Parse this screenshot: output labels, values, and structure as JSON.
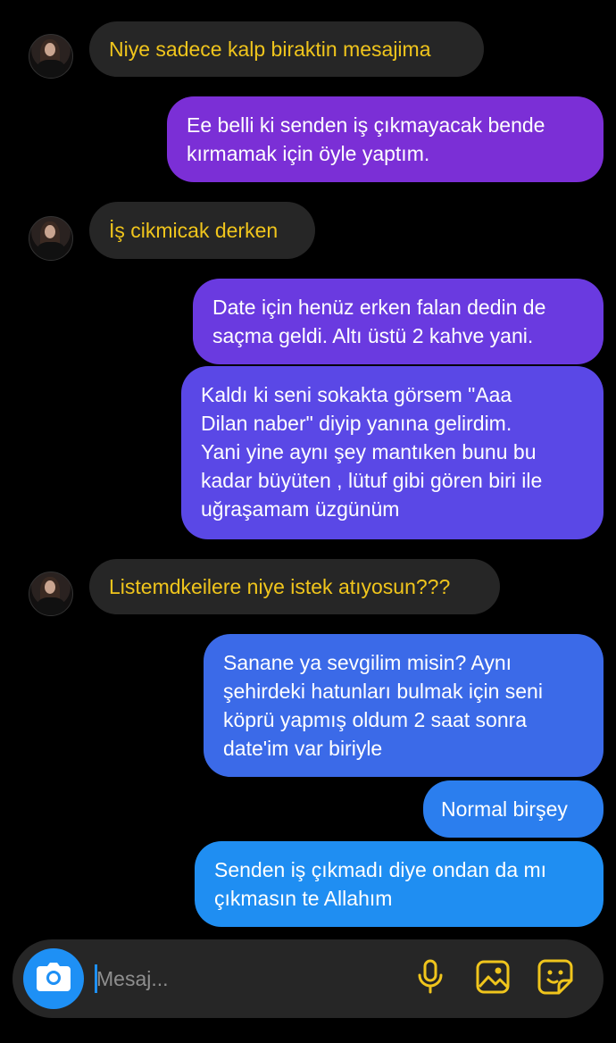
{
  "messages": [
    {
      "side": "in",
      "text": "Niye sadece kalp biraktin mesajima"
    },
    {
      "side": "out",
      "lines": [
        "Ee belli ki senden iş çıkmayacak bende",
        "kırmamak için öyle yaptım."
      ]
    },
    {
      "side": "in",
      "text": "İş cikmicak derken"
    },
    {
      "side": "out",
      "lines": [
        "Date için henüz erken falan dedin de",
        "saçma geldi. Altı üstü 2 kahve yani."
      ]
    },
    {
      "side": "out",
      "lines": [
        "Kaldı ki seni sokakta görsem \"Aaa",
        "Dilan naber\" diyip yanına gelirdim.",
        "Yani yine aynı şey mantıken bunu bu",
        "kadar büyüten , lütuf gibi gören biri ile",
        "uğraşamam üzgünüm"
      ]
    },
    {
      "side": "in",
      "text": "Listemdkeilere niye istek atıyosun???"
    },
    {
      "side": "out",
      "lines": [
        "Sanane ya sevgilim misin? Aynı",
        "şehirdeki hatunları bulmak için seni",
        "köprü yapmış oldum 2 saat sonra",
        "date'im var biriyle"
      ]
    },
    {
      "side": "out",
      "lines": [
        "Normal birşey"
      ]
    },
    {
      "side": "out",
      "lines": [
        "Senden iş çıkmadı diye ondan da mı",
        "çıkmasın te Allahım"
      ]
    }
  ],
  "composer": {
    "placeholder": "Mesaj...",
    "icons": [
      "camera-icon",
      "microphone-icon",
      "gallery-icon",
      "sticker-icon"
    ]
  },
  "colors": {
    "incoming_bubble": "#262626",
    "incoming_text": "#f0c51c",
    "outgoing_gradient": [
      "#7b2fd6",
      "#6a3ae0",
      "#5a48e6",
      "#3b6ae8",
      "#1f8ef2"
    ],
    "accent": "#1e90f5",
    "icon_yellow": "#f0c51c"
  }
}
